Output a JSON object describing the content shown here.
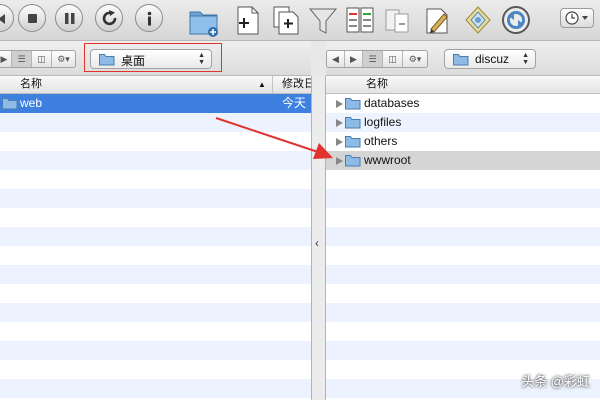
{
  "left_pane": {
    "location": "桌面",
    "columns": {
      "name": "名称",
      "modified": "修改日"
    },
    "items": [
      {
        "name": "web",
        "modified": "今天",
        "selected": true
      }
    ]
  },
  "right_pane": {
    "location": "discuz",
    "columns": {
      "name": "名称"
    },
    "items": [
      {
        "name": "databases"
      },
      {
        "name": "logfiles"
      },
      {
        "name": "others"
      },
      {
        "name": "wwwroot",
        "highlighted": true
      }
    ]
  },
  "toolbar": {
    "buttons": [
      "back-icon",
      "stop-icon",
      "pause-icon",
      "refresh-icon",
      "info-icon",
      "new-folder-icon",
      "new-file-icon",
      "duplicate-icon",
      "filter-icon",
      "compare-icon",
      "merge-icon",
      "edit-icon",
      "color-label-icon",
      "sync-icon"
    ],
    "view_menu_icon": "clock-icon"
  },
  "divider_handle": "‹",
  "watermark": "头条 @彩虹",
  "colors": {
    "selection_blue": "#3d80df",
    "callout_red": "#e0332f",
    "stripe": "#edf3fe"
  }
}
